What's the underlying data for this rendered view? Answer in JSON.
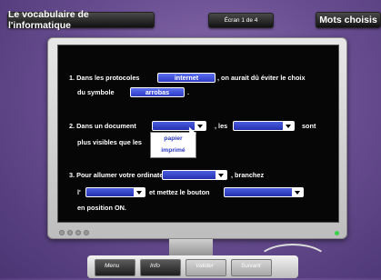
{
  "header": {
    "title": "Le vocabulaire de l'informatique",
    "counter": "Écran 1 de 4",
    "mode": "Mots choisis"
  },
  "exercises": [
    {
      "line1_prefix": "1. Dans les protocoles",
      "answer1": "internet",
      "line1_suffix": ", on aurait dû éviter le choix",
      "line2_prefix": "du symbole",
      "answer2": "arrobas",
      "line2_suffix": "."
    },
    {
      "line1_prefix": "2. Dans un document",
      "sep": ", les",
      "suffix": "sont",
      "line2": "plus visibles que les",
      "dropdown_options": [
        "papier",
        "imprimé"
      ]
    },
    {
      "line1_prefix": "3. Pour allumer votre ordinateur",
      "line1_suffix": ", branchez",
      "line2_prefix": "l'",
      "line2_mid": "et mettez le bouton",
      "line3": "en position ON."
    }
  ],
  "keys": [
    "Menu",
    "Info",
    "Valider",
    "Suivant"
  ]
}
